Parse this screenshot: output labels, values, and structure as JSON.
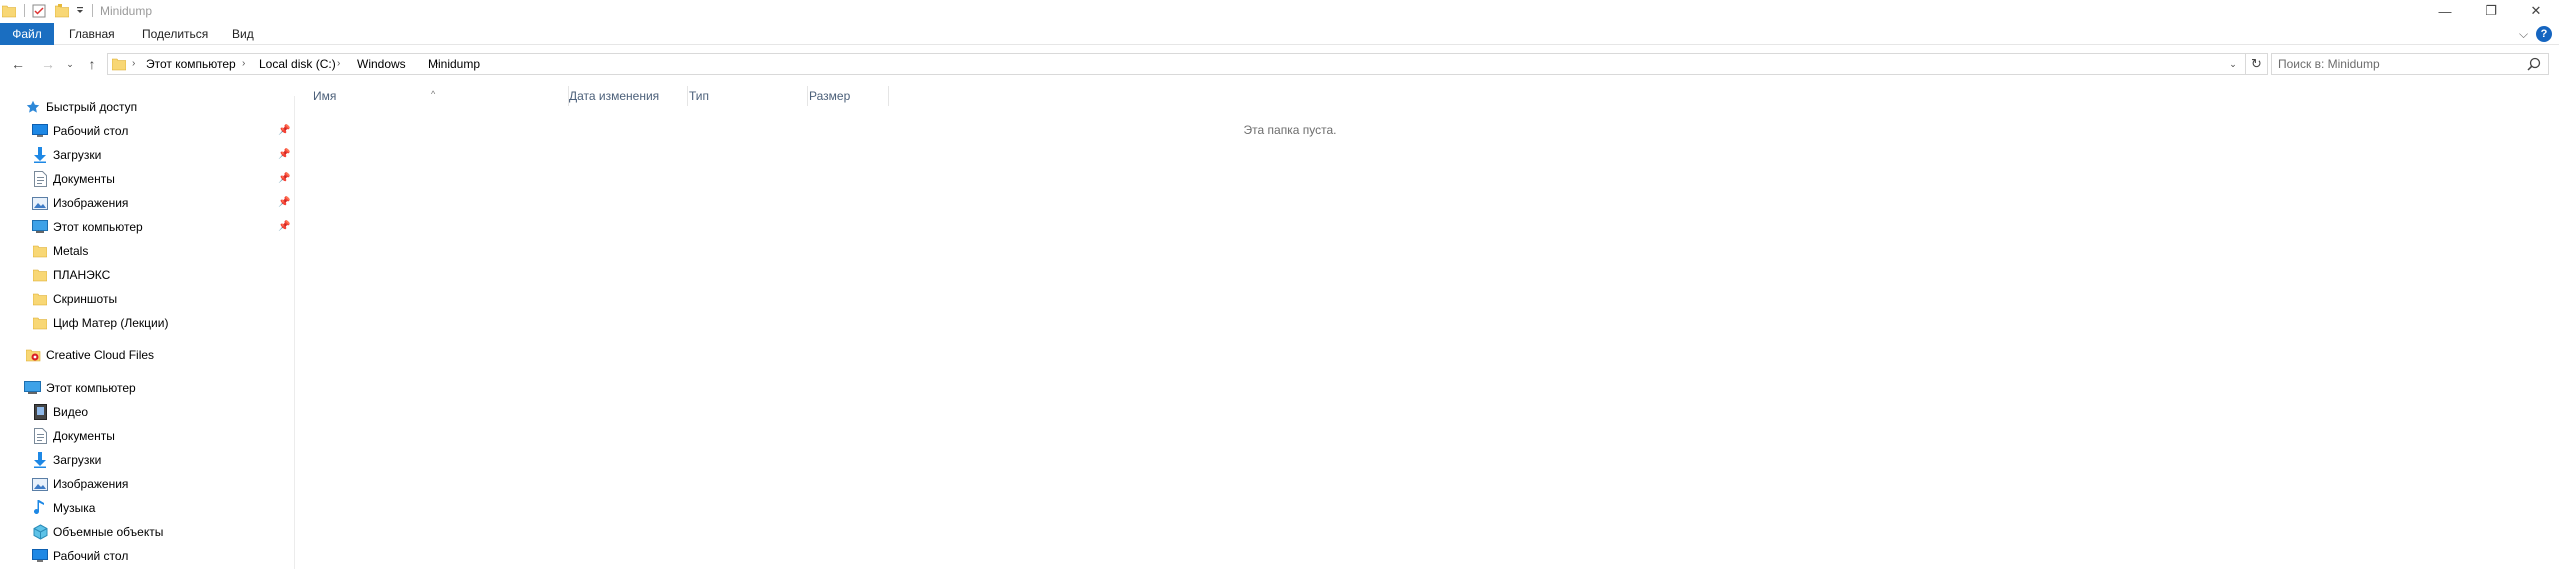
{
  "window": {
    "title": "Minidump",
    "minimize_glyph": "—",
    "maximize_glyph": "❐",
    "close_glyph": "✕"
  },
  "ribbon": {
    "tabs": [
      {
        "label": "Файл"
      },
      {
        "label": "Главная"
      },
      {
        "label": "Поделиться"
      },
      {
        "label": "Вид"
      }
    ],
    "expand_glyph": "⌵",
    "help_label": "?"
  },
  "nav": {
    "back_glyph": "←",
    "forward_glyph": "→",
    "recent_glyph": "⌄",
    "up_glyph": "↑",
    "dropdown_glyph": "⌄",
    "refresh_glyph": "↻",
    "breadcrumb": [
      {
        "label": "Этот компьютер"
      },
      {
        "label": "Local disk (C:)"
      },
      {
        "label": "Windows"
      },
      {
        "label": "Minidump"
      }
    ],
    "crumb_separator": "›",
    "search_placeholder": "Поиск в: Minidump"
  },
  "sidebar": {
    "quick_access_label": "Быстрый доступ",
    "quick_items": [
      {
        "label": "Рабочий стол",
        "icon": "desktop-icon",
        "pinned": true
      },
      {
        "label": "Загрузки",
        "icon": "downloads-icon",
        "pinned": true
      },
      {
        "label": "Документы",
        "icon": "documents-icon",
        "pinned": true
      },
      {
        "label": "Изображения",
        "icon": "pictures-icon",
        "pinned": true
      },
      {
        "label": "Этот компьютер",
        "icon": "computer-icon",
        "pinned": true
      },
      {
        "label": "Metals",
        "icon": "folder-icon",
        "pinned": false
      },
      {
        "label": "ПЛАНЭКС",
        "icon": "folder-icon",
        "pinned": false
      },
      {
        "label": "Скриншоты",
        "icon": "folder-icon",
        "pinned": false
      },
      {
        "label": "Циф Матер (Лекции)",
        "icon": "folder-icon",
        "pinned": false
      }
    ],
    "creative_cloud_label": "Creative Cloud Files",
    "this_pc_label": "Этот компьютер",
    "pc_items": [
      {
        "label": "Видео",
        "icon": "video-icon"
      },
      {
        "label": "Документы",
        "icon": "documents-icon"
      },
      {
        "label": "Загрузки",
        "icon": "downloads-icon"
      },
      {
        "label": "Изображения",
        "icon": "pictures-icon"
      },
      {
        "label": "Музыка",
        "icon": "music-icon"
      },
      {
        "label": "Объемные объекты",
        "icon": "3d-objects-icon"
      },
      {
        "label": "Рабочий стол",
        "icon": "desktop-icon"
      }
    ],
    "pin_glyph": "📌"
  },
  "content": {
    "columns": [
      {
        "label": "Имя"
      },
      {
        "label": "Дата изменения"
      },
      {
        "label": "Тип"
      },
      {
        "label": "Размер"
      }
    ],
    "sort_glyph": "^",
    "empty_message": "Эта папка пуста."
  },
  "colors": {
    "accent": "#1a6ec1",
    "folder": "#f8d775",
    "column_header_text": "#4c607a",
    "muted_text": "#6d6d6d"
  }
}
